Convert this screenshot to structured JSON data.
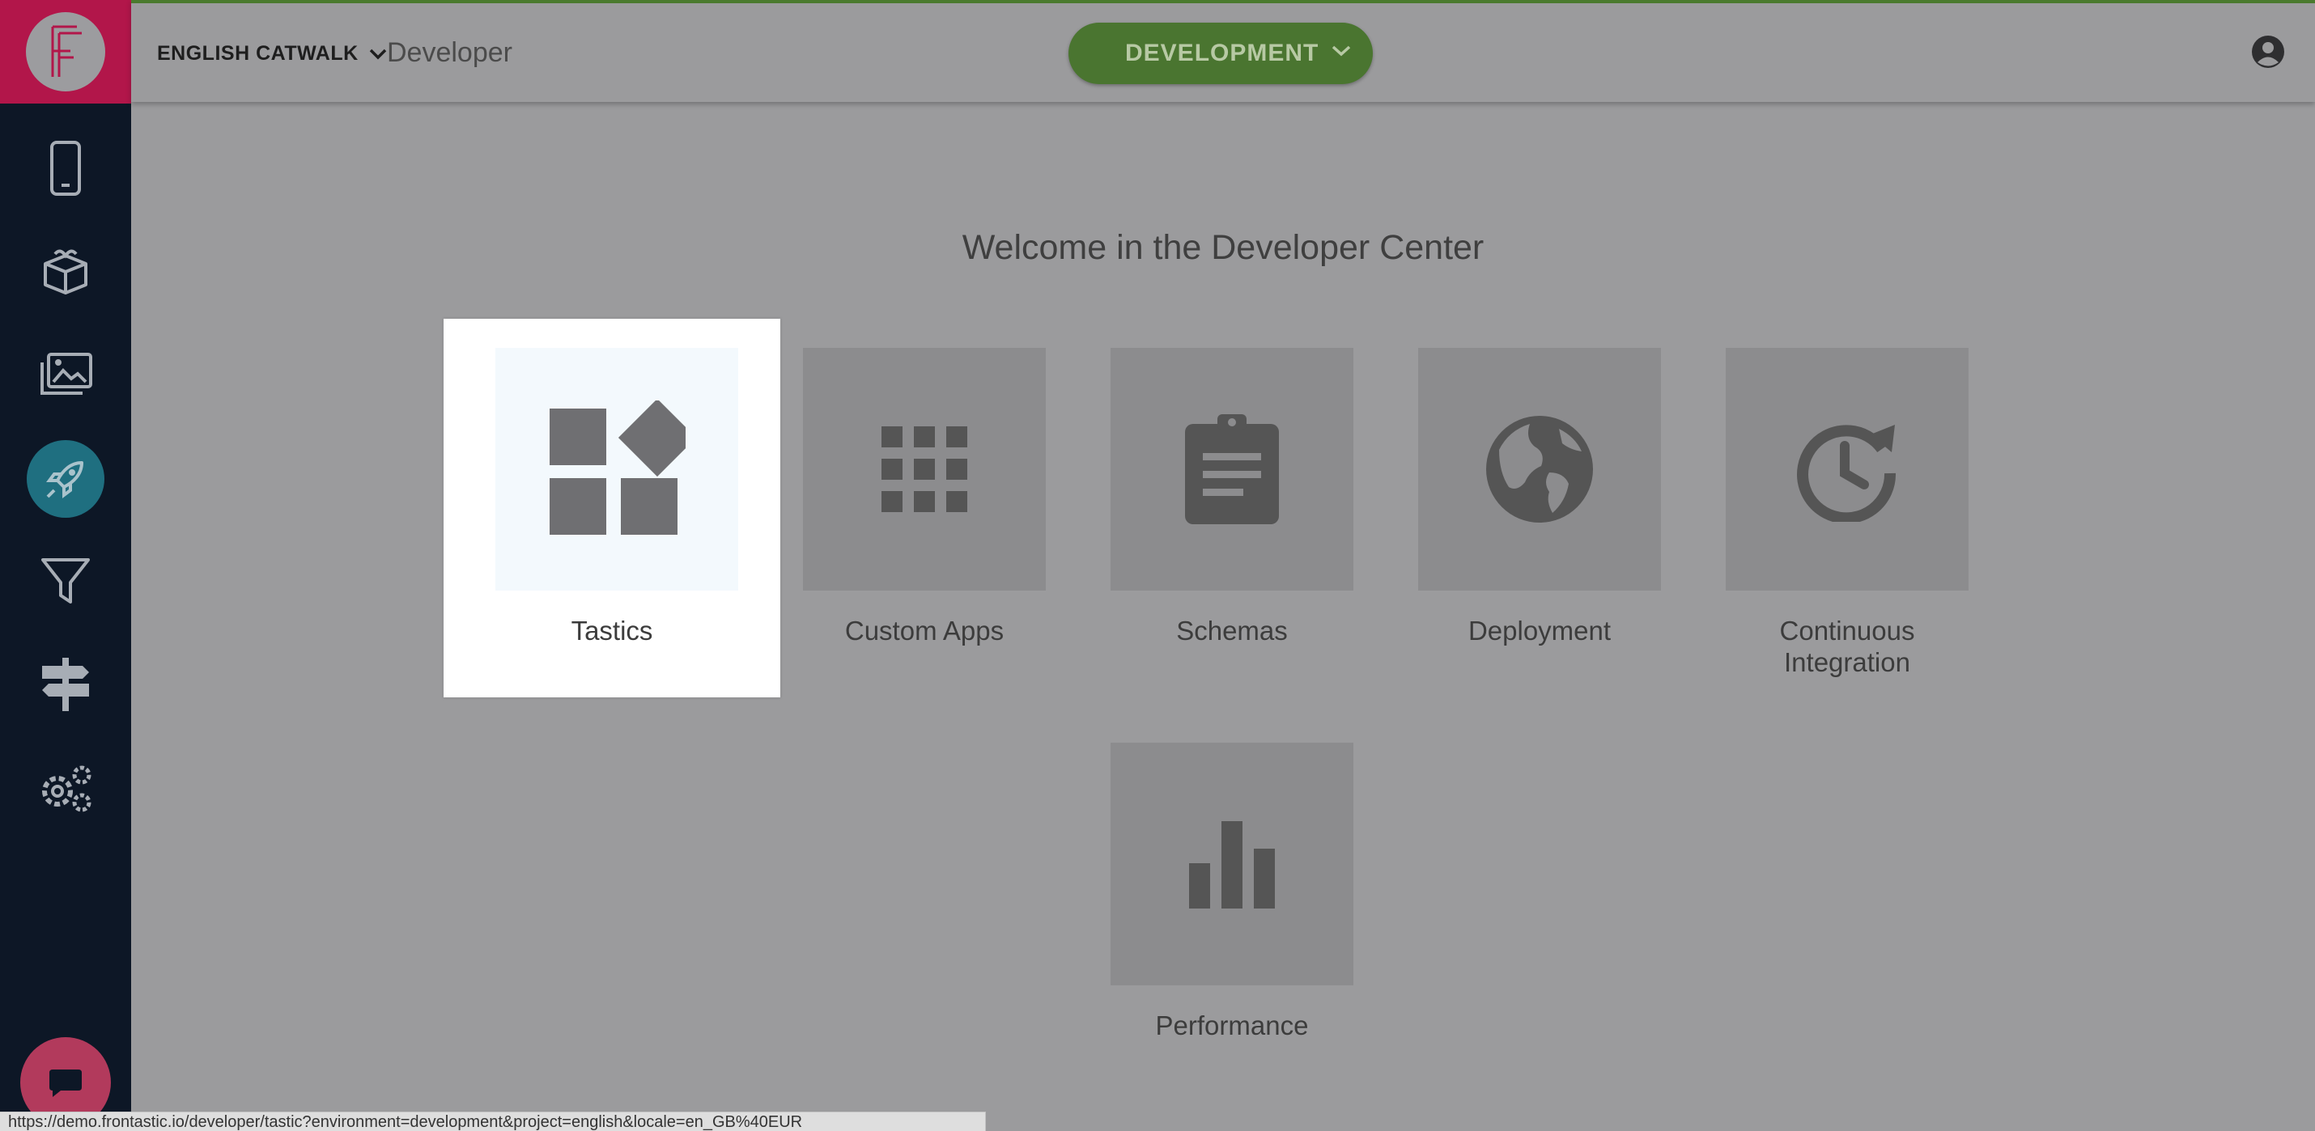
{
  "sidebar": {
    "logo_letter": "F",
    "items": [
      {
        "name": "mobile-phone-icon"
      },
      {
        "name": "box-icon"
      },
      {
        "name": "images-icon"
      },
      {
        "name": "rocket-icon",
        "active": true
      },
      {
        "name": "filter-icon"
      },
      {
        "name": "signpost-icon"
      },
      {
        "name": "gears-icon"
      }
    ],
    "chat_icon": "chat-bubble-icon"
  },
  "header": {
    "project": "ENGLISH CATWALK",
    "section": "Developer",
    "environment": "DEVELOPMENT",
    "user_icon": "user-circle-icon"
  },
  "main": {
    "welcome": "Welcome in the Developer Center",
    "cards": [
      {
        "label": "Tastics",
        "icon": "shapes-icon",
        "selected": true
      },
      {
        "label": "Custom Apps",
        "icon": "grid-icon"
      },
      {
        "label": "Schemas",
        "icon": "clipboard-icon"
      },
      {
        "label": "Deployment",
        "icon": "globe-icon"
      },
      {
        "label": "Continuous",
        "label2": "Integration",
        "icon": "history-icon"
      },
      {
        "label": "Performance",
        "icon": "bar-chart-icon"
      }
    ]
  },
  "status_url": "https://demo.frontastic.io/developer/tastic?environment=development&project=english&locale=en_GB%40EUR",
  "colors": {
    "sidebar": "#0d1726",
    "logo_bg": "#b2164a",
    "env_pill": "#4a7530",
    "active_nav": "#1f6f80",
    "page_bg": "#9b9b9d"
  }
}
